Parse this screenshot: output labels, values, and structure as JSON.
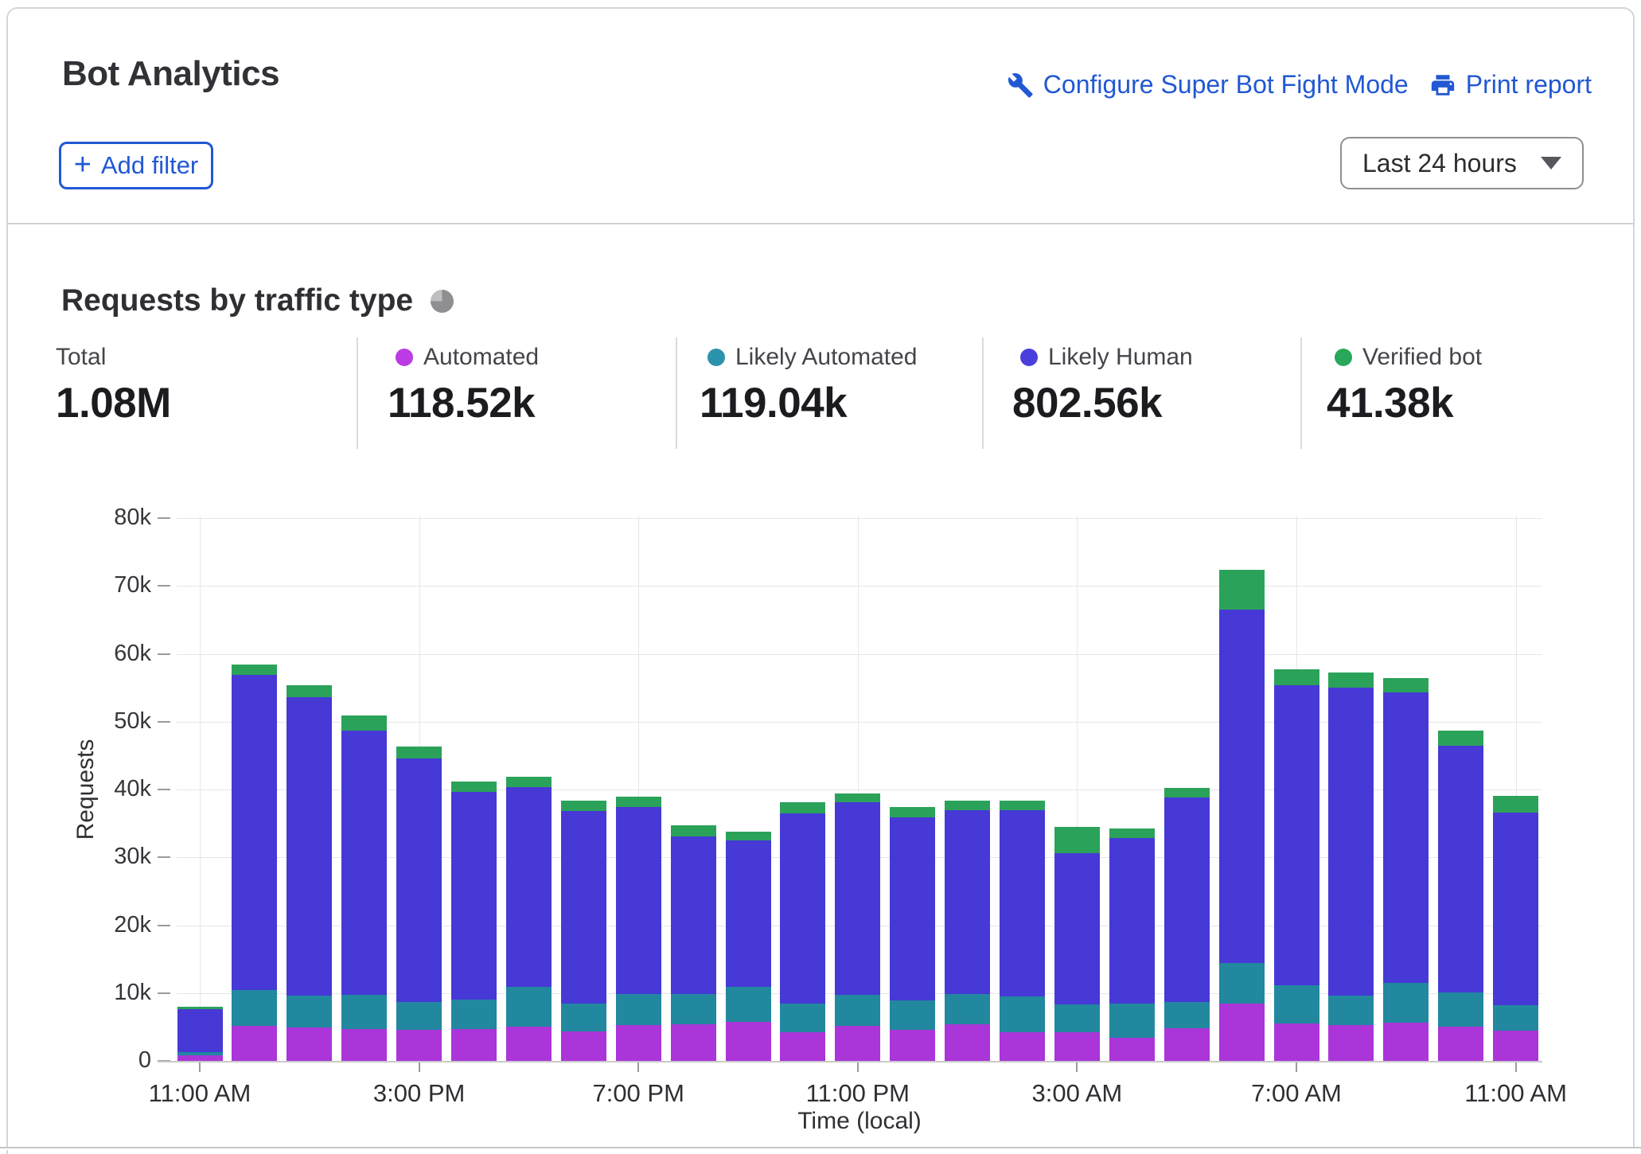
{
  "header": {
    "title": "Bot Analytics",
    "configure_link": "Configure Super Bot Fight Mode",
    "print_link": "Print report",
    "add_filter_plus": "+",
    "add_filter_label": "Add filter",
    "time_range_value": "Last 24 hours"
  },
  "section": {
    "title": "Requests by traffic type"
  },
  "stats": [
    {
      "label": "Total",
      "value": "1.08M",
      "dot_color": ""
    },
    {
      "label": "Automated",
      "value": "118.52k",
      "dot_color": "#bb3be4"
    },
    {
      "label": "Likely Automated",
      "value": "119.04k",
      "dot_color": "#2b93ab"
    },
    {
      "label": "Likely Human",
      "value": "802.56k",
      "dot_color": "#4a3fdd"
    },
    {
      "label": "Verified bot",
      "value": "41.38k",
      "dot_color": "#27a85b"
    }
  ],
  "chart_data": {
    "type": "bar",
    "stacked": true,
    "title": "Requests by traffic type",
    "xlabel": "Time (local)",
    "ylabel": "Requests",
    "units": "thousands of requests",
    "ylim": [
      0,
      80000
    ],
    "grid": true,
    "y_ticks": [
      "0",
      "10k",
      "20k",
      "30k",
      "40k",
      "50k",
      "60k",
      "70k",
      "80k"
    ],
    "x_tick_labels": [
      "11:00 AM",
      "3:00 PM",
      "7:00 PM",
      "11:00 PM",
      "3:00 AM",
      "7:00 AM",
      "11:00 AM"
    ],
    "categories": [
      "11:00 AM",
      "12:00 PM",
      "1:00 PM",
      "2:00 PM",
      "3:00 PM",
      "4:00 PM",
      "5:00 PM",
      "6:00 PM",
      "7:00 PM",
      "8:00 PM",
      "9:00 PM",
      "10:00 PM",
      "11:00 PM",
      "12:00 AM",
      "1:00 AM",
      "2:00 AM",
      "3:00 AM",
      "4:00 AM",
      "5:00 AM",
      "6:00 AM",
      "7:00 AM",
      "8:00 AM",
      "9:00 AM",
      "10:00 AM",
      "11:00 AM"
    ],
    "series": [
      {
        "name": "Automated",
        "color": "#aa35d9",
        "values": [
          0.8,
          5.2,
          4.9,
          4.7,
          4.6,
          4.7,
          5.1,
          4.3,
          5.3,
          5.4,
          5.7,
          4.2,
          5.2,
          4.6,
          5.4,
          4.2,
          4.2,
          3.4,
          4.8,
          8.4,
          5.5,
          5.3,
          5.6,
          5.1,
          4.5
        ]
      },
      {
        "name": "Likely Automated",
        "color": "#21889f",
        "values": [
          0.5,
          5.2,
          4.7,
          5.0,
          4.1,
          4.3,
          5.8,
          4.1,
          4.5,
          4.5,
          5.2,
          4.3,
          4.5,
          4.3,
          4.4,
          5.3,
          4.1,
          5.0,
          3.9,
          6.0,
          5.6,
          4.3,
          5.9,
          5.0,
          3.7
        ]
      },
      {
        "name": "Likely Human",
        "color": "#4639d6",
        "values": [
          6.3,
          46.5,
          44.0,
          39.0,
          35.9,
          30.6,
          29.5,
          28.4,
          27.6,
          23.2,
          21.6,
          28.0,
          28.4,
          27.0,
          27.1,
          27.5,
          22.3,
          24.5,
          30.1,
          52.1,
          44.3,
          45.4,
          42.8,
          36.3,
          28.4
        ]
      },
      {
        "name": "Verified bot",
        "color": "#2ba25a",
        "values": [
          0.4,
          1.5,
          1.8,
          2.2,
          1.7,
          1.6,
          1.5,
          1.5,
          1.6,
          1.6,
          1.3,
          1.6,
          1.3,
          1.5,
          1.4,
          1.3,
          3.9,
          1.4,
          1.4,
          5.9,
          2.3,
          2.3,
          2.1,
          2.3,
          2.5
        ]
      }
    ],
    "totals_legend": {
      "total": "1.08M",
      "automated": "118.52k",
      "likely_automated": "119.04k",
      "likely_human": "802.56k",
      "verified_bot": "41.38k"
    }
  }
}
